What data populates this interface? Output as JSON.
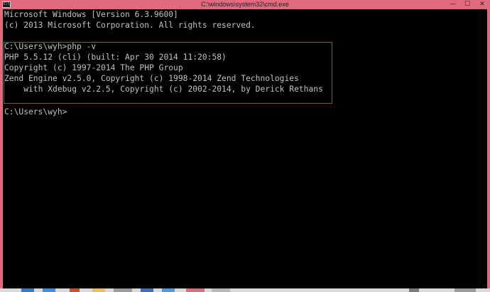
{
  "window": {
    "title": "C:\\windows\\system32\\cmd.exe",
    "icon_label": "C:\\",
    "minimize_glyph": "—",
    "maximize_glyph": "☐",
    "close_glyph": "✕"
  },
  "console": {
    "lines": [
      "Microsoft Windows [Version 6.3.9600]",
      "(c) 2013 Microsoft Corporation. All rights reserved.",
      "",
      "C:\\Users\\wyh>php -v",
      "PHP 5.5.12 (cli) (built: Apr 30 2014 11:20:58)",
      "Copyright (c) 1997-2014 The PHP Group",
      "Zend Engine v2.5.0, Copyright (c) 1998-2014 Zend Technologies",
      "    with Xdebug v2.2.5, Copyright (c) 2002-2014, by Derick Rethans",
      "",
      "C:\\Users\\wyh>"
    ]
  },
  "colors": {
    "title_bar": "#e16a7e",
    "console_bg": "#000000",
    "console_text": "#c0c0c0",
    "highlight": "#c0392b"
  }
}
